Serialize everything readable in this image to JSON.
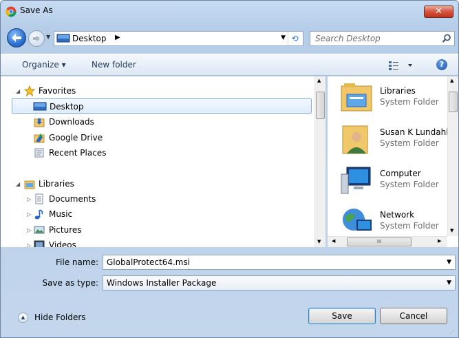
{
  "window": {
    "title": "Save As",
    "close_label": "✕"
  },
  "address": {
    "location": "Desktop",
    "search_placeholder": "Search Desktop"
  },
  "toolbar": {
    "organize_label": "Organize ▾",
    "new_folder_label": "New folder",
    "help_label": "?"
  },
  "nav": {
    "favorites": {
      "label": "Favorites",
      "items": [
        {
          "label": "Desktop",
          "icon": "desktop-icon",
          "selected": true
        },
        {
          "label": "Downloads",
          "icon": "downloads-folder-icon"
        },
        {
          "label": "Google Drive",
          "icon": "google-drive-folder-icon"
        },
        {
          "label": "Recent Places",
          "icon": "recent-places-icon"
        }
      ]
    },
    "libraries": {
      "label": "Libraries",
      "items": [
        {
          "label": "Documents",
          "icon": "documents-icon"
        },
        {
          "label": "Music",
          "icon": "music-icon"
        },
        {
          "label": "Pictures",
          "icon": "pictures-icon"
        },
        {
          "label": "Videos",
          "icon": "videos-icon"
        }
      ]
    }
  },
  "files": [
    {
      "name": "Libraries",
      "type": "System Folder",
      "icon": "libraries-icon"
    },
    {
      "name": "Susan K Lundahl",
      "type": "System Folder",
      "icon": "user-folder-icon"
    },
    {
      "name": "Computer",
      "type": "System Folder",
      "icon": "computer-icon"
    },
    {
      "name": "Network",
      "type": "System Folder",
      "icon": "network-icon"
    }
  ],
  "form": {
    "file_name_label": "File name:",
    "file_name_value": "GlobalProtect64.msi",
    "save_type_label": "Save as type:",
    "save_type_value": "Windows Installer Package"
  },
  "buttons": {
    "hide_folders": "Hide Folders",
    "save": "Save",
    "cancel": "Cancel"
  },
  "colors": {
    "accent": "#2a6fd0",
    "selection": "#dfecfb",
    "close": "#c0331b"
  }
}
